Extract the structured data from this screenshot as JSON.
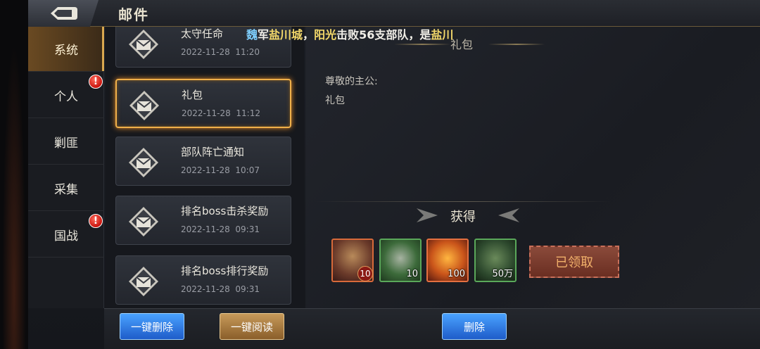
{
  "header": {
    "title": "邮件"
  },
  "categories": [
    {
      "label": "系统",
      "active": true,
      "badge": ""
    },
    {
      "label": "个人",
      "active": false,
      "badge": "!"
    },
    {
      "label": "剿匪",
      "active": false,
      "badge": ""
    },
    {
      "label": "采集",
      "active": false,
      "badge": ""
    },
    {
      "label": "国战",
      "active": false,
      "badge": "!"
    }
  ],
  "mails": [
    {
      "subject": "太守任命",
      "date": "2022-11-28",
      "time": "11:20"
    },
    {
      "subject": "礼包",
      "date": "2022-11-28",
      "time": "11:12"
    },
    {
      "subject": "部队阵亡通知",
      "date": "2022-11-28",
      "time": "10:07"
    },
    {
      "subject": "排名boss击杀奖励",
      "date": "2022-11-28",
      "time": "09:31"
    },
    {
      "subject": "排名boss排行奖励",
      "date": "2022-11-28",
      "time": "09:31"
    }
  ],
  "ticker": {
    "part1": "魏",
    "part2": "军",
    "part3": "盐川城",
    "part4": "，",
    "part5": "阳光",
    "part6": "击败56支部队，是",
    "part7": "盐川"
  },
  "detail": {
    "title": "礼包",
    "greeting": "尊敬的主公:",
    "body": "礼包",
    "reward_title": "获得",
    "rewards": [
      {
        "count": "10",
        "level": "10"
      },
      {
        "count": "10"
      },
      {
        "count": "100"
      },
      {
        "count": "50万"
      }
    ],
    "claimed_label": "已领取"
  },
  "bottom": {
    "delete_all": "一键删除",
    "read_all": "一键阅读",
    "delete": "删除"
  },
  "colors": {
    "accent_gold": "#f0b04a",
    "badge_red": "#c9140e",
    "button_blue": "#1e5cc9"
  }
}
